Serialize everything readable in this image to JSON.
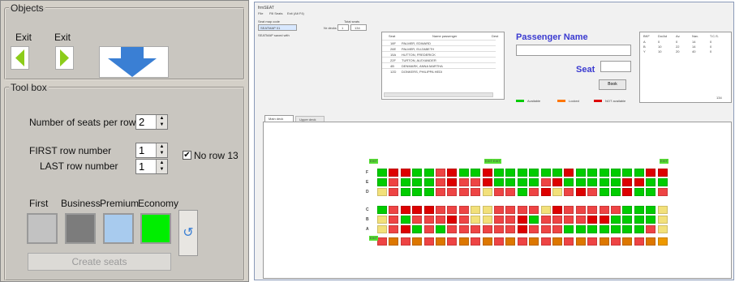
{
  "left": {
    "objects_legend": "Objects",
    "exit1_label": "Exit",
    "exit2_label": "Exit",
    "toolbox_legend": "Tool box",
    "seats_per_row_label": "Number of seats per row",
    "seats_per_row_value": "2",
    "first_row_label": "FIRST row number",
    "first_row_value": "1",
    "last_row_label": "LAST row number",
    "last_row_value": "1",
    "no_row13_label": "No row 13",
    "classes": [
      "First",
      "Business",
      "Premium",
      "Economy"
    ],
    "class_colors": [
      "#c2c2c2",
      "#7c7c7c",
      "#a8cbee",
      "#00ee00"
    ],
    "create_label": "Create seats"
  },
  "right": {
    "window_title": "frmSEAT",
    "menu": [
      "File",
      "Fill Seats",
      "Exit (Alt F4)"
    ],
    "seatmap_code_label": "Seat map code",
    "total_seats_label": "Total seats",
    "seatmap_code_value": "SEATMAP 01",
    "nr_decks_label": "Nr decks",
    "nr_decks_value": "1",
    "total_seats_value": "134",
    "status_text": "SEATMAP saved with",
    "pax_header": [
      "Seat",
      "Name passenger",
      "Dest"
    ],
    "pax_rows": [
      [
        "18F",
        "PALMER, EDWARD"
      ],
      [
        "26E",
        "PALMER, ELIZABETH"
      ],
      [
        "15A",
        "HUTTON, FREDERICK"
      ],
      [
        "22F",
        "TURTON, ALEXANDER"
      ],
      [
        "4B",
        "DENMARK, ANNA MARTHA"
      ],
      [
        "12D",
        "DONKERS, PHILIPPA HEDI"
      ]
    ],
    "pax_name_label": "Passenger Name",
    "seat_label": "Seat",
    "book_btn": "Book",
    "legend": [
      "Available",
      "Locked",
      "NOT available"
    ],
    "legend_colors": [
      "#00cc00",
      "#ff7700",
      "#dd0000"
    ],
    "summary_header": [
      "BKF",
      "Do/Ad",
      "Av.",
      "Nav.",
      "T.C.S."
    ],
    "summary_rows": [
      [
        "A",
        "0",
        "0",
        "14",
        "0"
      ],
      [
        "B",
        "10",
        "22",
        "14",
        "0"
      ],
      [
        "Y",
        "10",
        "20",
        "40",
        "0"
      ]
    ],
    "summary_total": "134",
    "tabs": [
      "Main deck",
      "Upper deck"
    ],
    "exit_tags": [
      "EXIT",
      "EXIT EXIT",
      "EXIT",
      "EXIT"
    ],
    "row_letters_top": [
      "F",
      "E",
      "D"
    ],
    "row_letters_bottom": [
      "C",
      "B",
      "A"
    ]
  }
}
